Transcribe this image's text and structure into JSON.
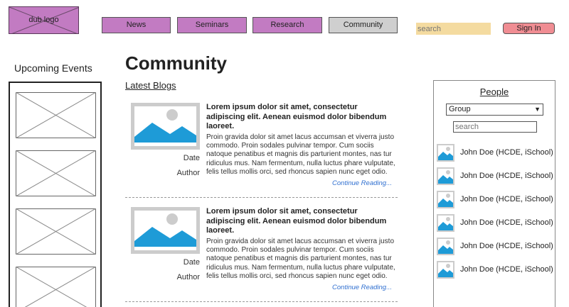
{
  "header": {
    "logo": "dub logo",
    "nav": [
      {
        "label": "News"
      },
      {
        "label": "Seminars"
      },
      {
        "label": "Research"
      },
      {
        "label": "Community",
        "active": true
      }
    ],
    "search_placeholder": "search",
    "signin_label": "Sign In"
  },
  "events": {
    "title": "Upcoming Events"
  },
  "main": {
    "title": "Community",
    "section": "Latest Blogs",
    "posts": [
      {
        "headline": "Lorem ipsum dolor sit amet, consectetur adipiscing elit. Aenean euismod dolor bibendum laoreet.",
        "body": "Proin gravida dolor sit amet lacus accumsan et viverra justo commodo. Proin sodales pulvinar tempor. Cum sociis natoque penatibus et magnis dis parturient montes, nas tur ridiculus mus. Nam fermentum, nulla luctus phare vulputate, felis tellus mollis orci, sed rhoncus sapien nunc eget odio.",
        "date_label": "Date",
        "author_label": "Author",
        "more_label": "Continue Reading..."
      },
      {
        "headline": "Lorem ipsum dolor sit amet, consectetur adipiscing elit. Aenean euismod dolor bibendum laoreet.",
        "body": "Proin gravida dolor sit amet lacus accumsan et viverra justo commodo. Proin sodales pulvinar tempor. Cum sociis natoque penatibus et magnis dis parturient montes, nas tur ridiculus mus. Nam fermentum, nulla luctus phare vulputate, felis tellus mollis orci, sed rhoncus sapien nunc eget odio.",
        "date_label": "Date",
        "author_label": "Author",
        "more_label": "Continue Reading..."
      }
    ]
  },
  "people": {
    "title": "People",
    "group_select": "Group",
    "search_placeholder": "search",
    "list": [
      {
        "name": "John Doe (HCDE, iSchool)"
      },
      {
        "name": "John Doe (HCDE, iSchool)"
      },
      {
        "name": "John Doe (HCDE, iSchool)"
      },
      {
        "name": "John Doe (HCDE, iSchool)"
      },
      {
        "name": "John Doe (HCDE, iSchool)"
      },
      {
        "name": "John Doe (HCDE, iSchool)"
      }
    ]
  },
  "icons": {
    "select_arrow": "chevron-down-icon",
    "thumbnail": "image-placeholder-icon",
    "avatar": "image-placeholder-icon"
  },
  "colors": {
    "nav_purple": "#c27bc2",
    "nav_active": "#cfcfcf",
    "search_bg": "#f4dba0",
    "signin_bg": "#f08d93",
    "link_blue": "#2f6fd0",
    "image_blue": "#1e9bd7"
  }
}
